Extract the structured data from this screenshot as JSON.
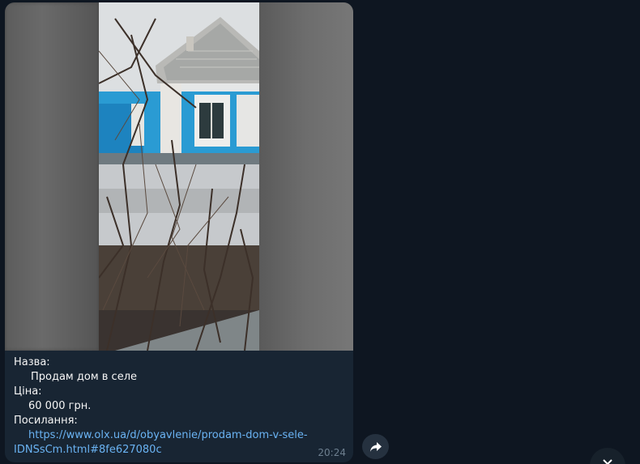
{
  "message": {
    "fields": [
      {
        "label": "Назва:",
        "value": "Продам дом в селе"
      },
      {
        "label": "Ціна:",
        "value": "60 000 грн."
      },
      {
        "label": "Посилання:",
        "value_line1": "https://www.olx.ua/d/obyavlenie/prodam-dom-v-sele-",
        "value_line2": "IDNSsCm.html#8fe627080c"
      }
    ],
    "time": "20:24",
    "media_icon": "house-photo"
  },
  "buttons": {
    "forward_icon": "share-arrow-icon",
    "scroll_down_icon": "chevron-down-icon"
  },
  "colors": {
    "background": "#0e1621",
    "bubble": "#182533",
    "link": "#6ab3f3",
    "text": "#f5f5f5",
    "time": "#6d7f8f"
  }
}
